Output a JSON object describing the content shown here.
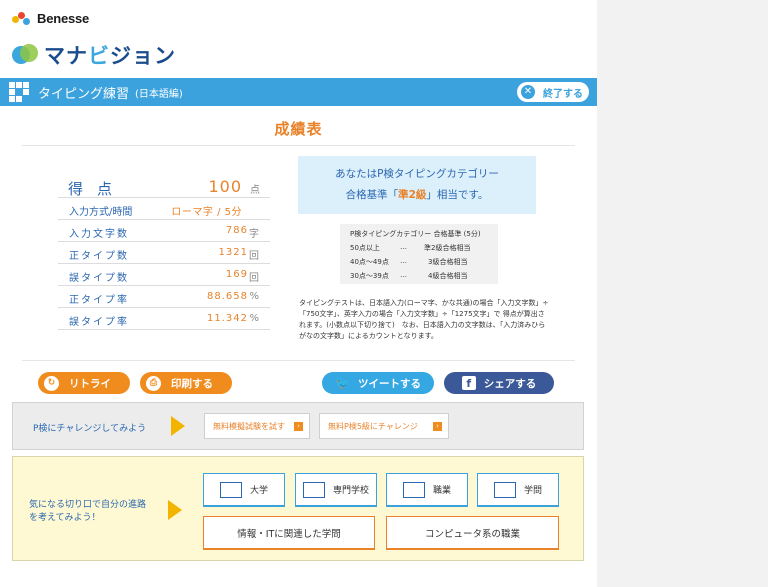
{
  "brand": {
    "benesse": "Benesse",
    "manabi_prefix": "マナ",
    "manabi_hl": "ビ",
    "manabi_suffix": "ジョン"
  },
  "bar": {
    "title": "タイピング練習",
    "subtitle": "(日本語編)",
    "end_label": "終了する"
  },
  "result": {
    "title": "成績表",
    "rows": [
      {
        "key": "得点",
        "value": "100",
        "unit": "点"
      },
      {
        "key": "入力方式/時間",
        "value": "ローマ字 / 5分",
        "unit": ""
      },
      {
        "key": "入力文字数",
        "value": "786",
        "unit": "字"
      },
      {
        "key": "正タイプ数",
        "value": "1321",
        "unit": "回"
      },
      {
        "key": "誤タイプ数",
        "value": "169",
        "unit": "回"
      },
      {
        "key": "正タイプ率",
        "value": "88.658",
        "unit": "%"
      },
      {
        "key": "誤タイプ率",
        "value": "11.342",
        "unit": "%"
      }
    ]
  },
  "category": {
    "line1": "あなたはP検タイピングカテゴリー",
    "line2_pre": "合格基準「",
    "grade": "準2級",
    "line2_post": "」相当です。",
    "criteria_header": "P検タイピングカテゴリー 合格基準 (5分)",
    "criteria": [
      {
        "range": "50点以上",
        "dots": "…",
        "level": "準2級合格相当"
      },
      {
        "range": "40点〜49点",
        "dots": "…",
        "level": "3級合格相当"
      },
      {
        "range": "30点〜39点",
        "dots": "…",
        "level": "4級合格相当"
      }
    ],
    "note": "タイピングテストは、日本語入力(ローマ字、かな共通)の場合「入力文字数」÷「750文字」、英字入力の場合「入力文字数」÷「1275文字」で 得点が算出されます。(小数点以下切り捨て)　なお、日本語入力の文字数は、「入力済みひらがなの文字数」によるカウントとなります。"
  },
  "actions": {
    "retry": "リトライ",
    "print": "印刷する",
    "tweet": "ツイートする",
    "share": "シェアする"
  },
  "challenge": {
    "text": "P検にチャレンジしてみよう",
    "btn1": "無料模擬試験を試す",
    "btn2": "無料P検5級にチャレンジ"
  },
  "explore": {
    "text_l1": "気になる切り口で自分の進路",
    "text_l2": "を考えてみよう！",
    "cats": [
      "大学",
      "専門学校",
      "職業",
      "学問"
    ],
    "wide1": "情報・ITに関連した学問",
    "wide2": "コンピュータ系の職業"
  },
  "colors": {
    "accent": "#3ba2dd",
    "orange": "#e8832b",
    "twitter": "#35a7e3",
    "facebook": "#3b5998"
  }
}
